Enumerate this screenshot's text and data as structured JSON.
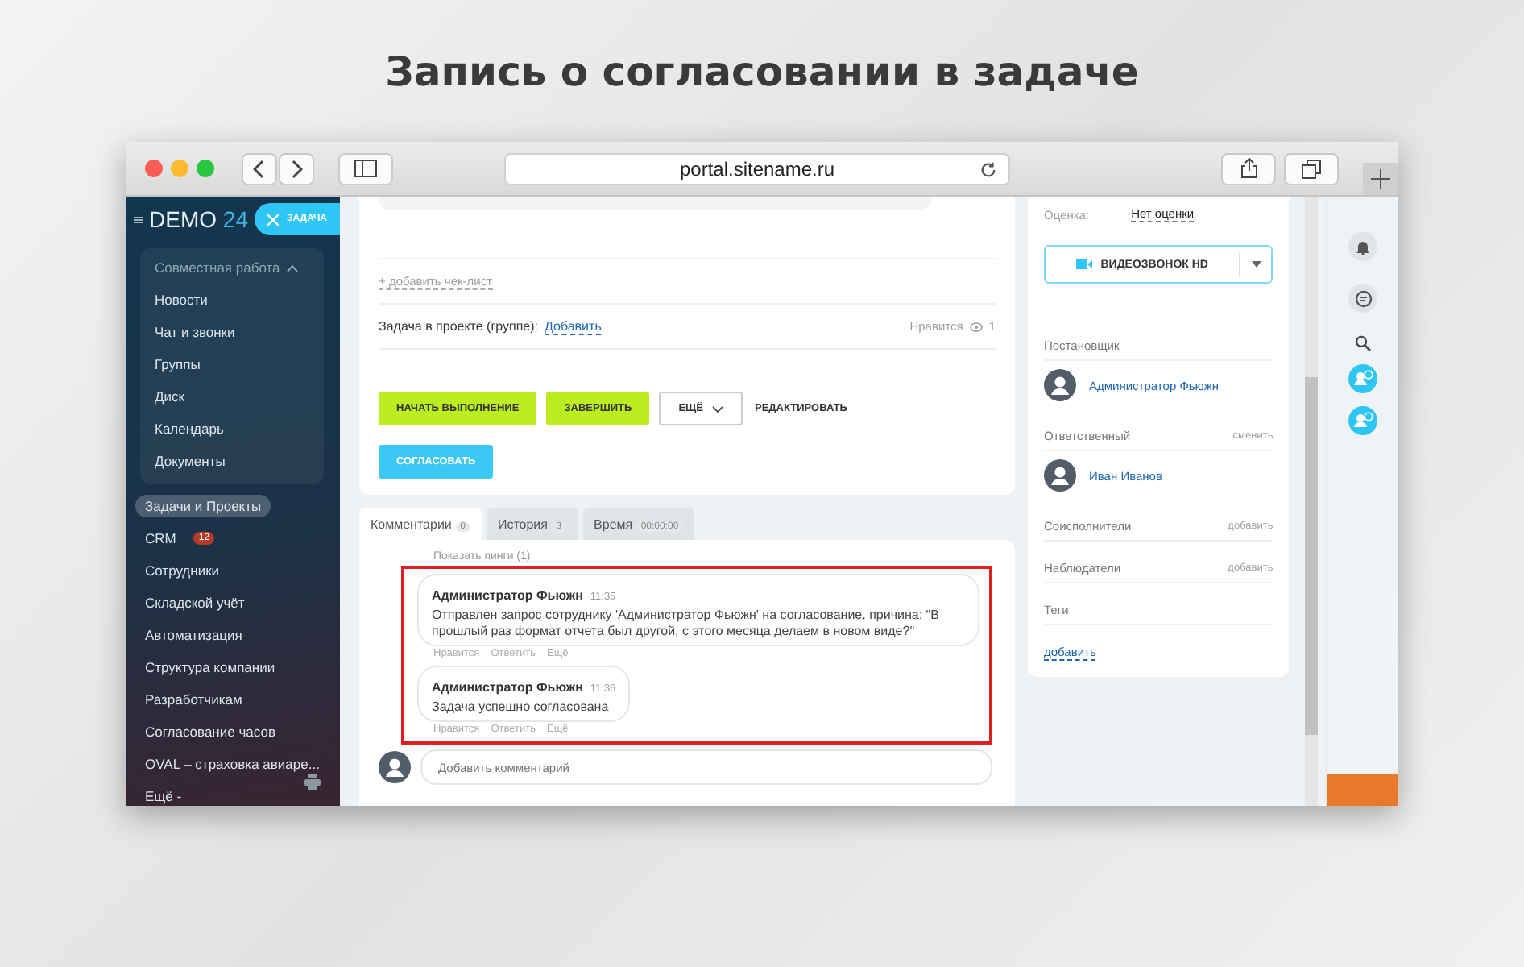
{
  "page_title": "Запись о согласовании в задаче",
  "browser": {
    "url": "portal.sitename.ru"
  },
  "sidebar": {
    "logo_name": "DEMO",
    "logo_number": "24",
    "task_button": "ЗАДАЧА",
    "group": {
      "label": "Совместная работа",
      "expanded": true,
      "items": [
        "Новости",
        "Чат и звонки",
        "Группы",
        "Диск",
        "Календарь",
        "Документы"
      ]
    },
    "items": [
      {
        "label": "Задачи и Проекты",
        "selected": true
      },
      {
        "label": "CRM",
        "badge": "12",
        "selected": false
      },
      {
        "label": "Сотрудники",
        "selected": false
      },
      {
        "label": "Складской учёт",
        "selected": false
      },
      {
        "label": "Автоматизация",
        "selected": false
      },
      {
        "label": "Структура компании",
        "selected": false
      },
      {
        "label": "Разработчикам",
        "selected": false
      },
      {
        "label": "Согласование часов",
        "selected": false
      },
      {
        "label": "OVAL – страховка авиаре...",
        "selected": false
      },
      {
        "label": "Ещё -",
        "selected": false
      }
    ]
  },
  "task": {
    "checklist_link": "+ добавить чек-лист",
    "project_label": "Задача в проекте (группе):",
    "project_link": "Добавить",
    "likes": "Нравится",
    "views": "1"
  },
  "actions": [
    {
      "label": "НАЧАТЬ ВЫПОЛНЕНИЕ",
      "kind": "primary"
    },
    {
      "label": "ЗАВЕРШИТЬ",
      "kind": "primary"
    },
    {
      "label": "ЕЩЁ",
      "kind": "dropdown"
    },
    {
      "label": "РЕДАКТИРОВАТЬ",
      "kind": "link"
    },
    {
      "label": "СОГЛАСОВАТЬ",
      "kind": "approve"
    }
  ],
  "tabs": [
    {
      "label": "Комментарии",
      "count": "0",
      "selected": true
    },
    {
      "label": "История",
      "count": "3",
      "selected": false
    },
    {
      "label": "Время",
      "count": "00:00:00",
      "selected": false
    }
  ],
  "show_pings": "Показать пинги (1)",
  "comments_highlighted": true,
  "comments": [
    {
      "author": "Администратор Фьюжн",
      "time": "11:35",
      "text": "Отправлен запрос сотруднику 'Администратор Фьюжн' на согласование, причина: \"В прошлый раз формат отчета был другой,  с этого месяца  делаем в новом виде?\"",
      "actions": [
        "Нравится",
        "Ответить",
        "Ещё"
      ]
    },
    {
      "author": "Администратор Фьюжн",
      "time": "11:36",
      "text": "Задача успешно согласована",
      "actions": [
        "Нравится",
        "Ответить",
        "Ещё"
      ]
    }
  ],
  "comment_input": {
    "placeholder": "Добавить комментарий"
  },
  "details": {
    "rating_label": "Оценка:",
    "rating_value": "Нет оценки",
    "video_call": "ВИДЕОЗВОНОК HD",
    "roles": [
      {
        "label": "Постановщик",
        "people": [
          "Администратор Фьюжн"
        ]
      },
      {
        "label": "Ответственный",
        "action": "сменить",
        "people": [
          "Иван Иванов"
        ]
      },
      {
        "label": "Соисполнители",
        "action": "добавить"
      },
      {
        "label": "Наблюдатели",
        "action": "добавить"
      },
      {
        "label": "Теги",
        "link": "добавить"
      }
    ]
  }
}
